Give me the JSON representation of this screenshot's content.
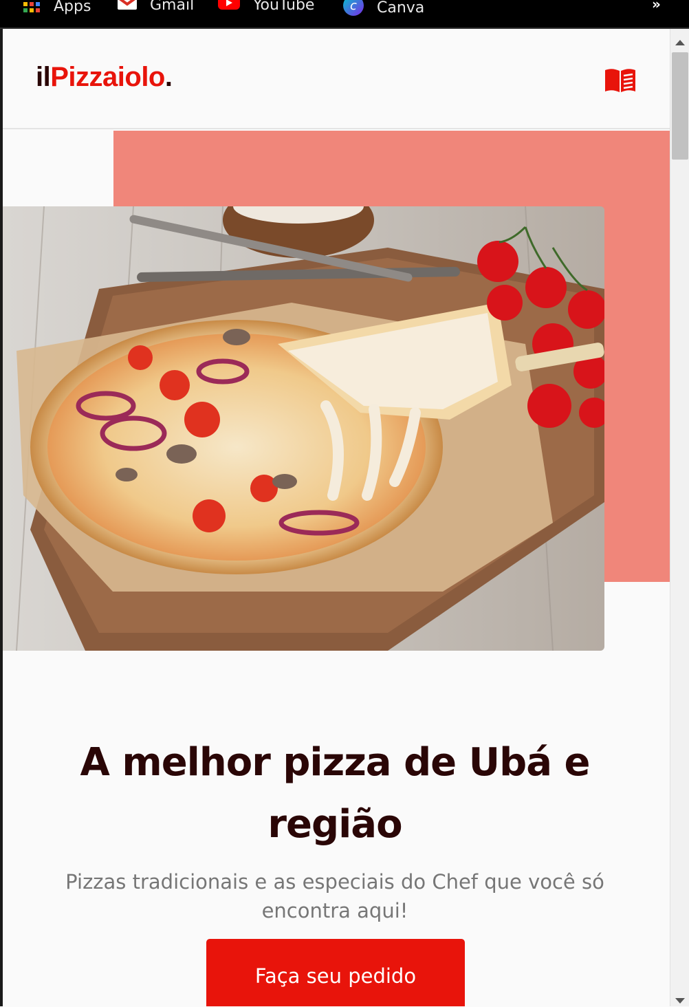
{
  "bookmarks": [
    {
      "label": "Apps",
      "icon": "apps-grid-icon"
    },
    {
      "label": "Gmail",
      "icon": "gmail-icon"
    },
    {
      "label": "YouTube",
      "icon": "youtube-icon"
    },
    {
      "label": "Canva",
      "icon": "canva-icon"
    }
  ],
  "bookmarks_more": "»",
  "header": {
    "logo_prefix": "il",
    "logo_name": "Pizzaiolo",
    "logo_suffix": ".",
    "menu_icon": "open-book-menu-icon"
  },
  "hero": {
    "image": "pizza-photo"
  },
  "content": {
    "headline": "A melhor pizza de Ubá e região",
    "subtitle": "Pizzas tradicionais e as especiais do Chef que você só encontra aqui!",
    "cta_label": "Faça seu pedido"
  },
  "colors": {
    "brand_red": "#e8140b",
    "dark_text": "#2a0606",
    "salmon": "#f0867a"
  }
}
